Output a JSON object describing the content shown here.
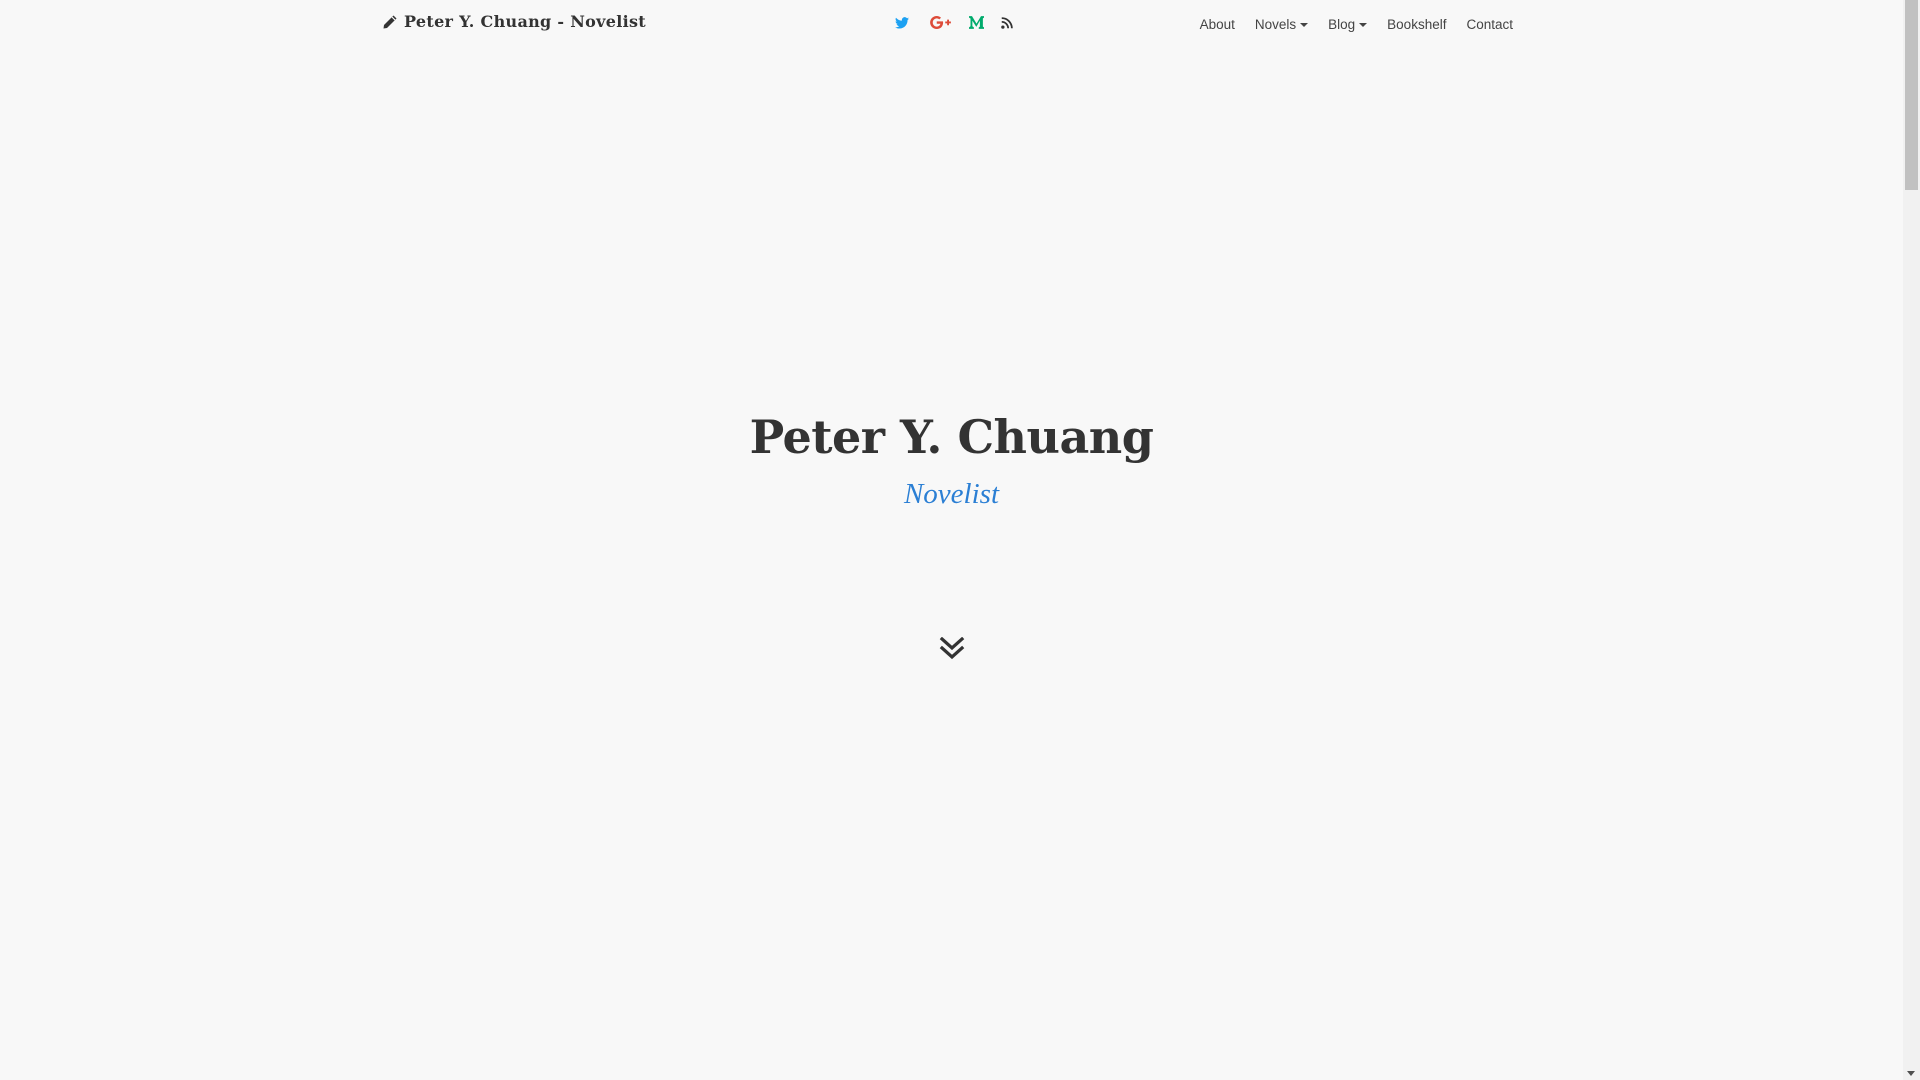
{
  "navbar": {
    "brand": "Peter Y. Chuang - Novelist",
    "brand_icon": "pencil-icon",
    "social": [
      {
        "name": "twitter-icon",
        "color": "#1da1f2"
      },
      {
        "name": "google-plus-icon",
        "color": "#dd4b39"
      },
      {
        "name": "medium-icon",
        "color": "#00ab6c"
      },
      {
        "name": "rss-icon",
        "color": "#333333"
      }
    ],
    "menu": {
      "about": "About",
      "novels": "Novels",
      "blog": "Blog",
      "bookshelf": "Bookshelf",
      "contact": "Contact"
    }
  },
  "hero": {
    "title": "Peter Y. Chuang",
    "subtitle": "Novelist",
    "scroll_icon": "double-chevron-down-icon"
  },
  "colors": {
    "background": "#f8f8f8",
    "accent": "#2b7fd4",
    "text": "#333333"
  }
}
